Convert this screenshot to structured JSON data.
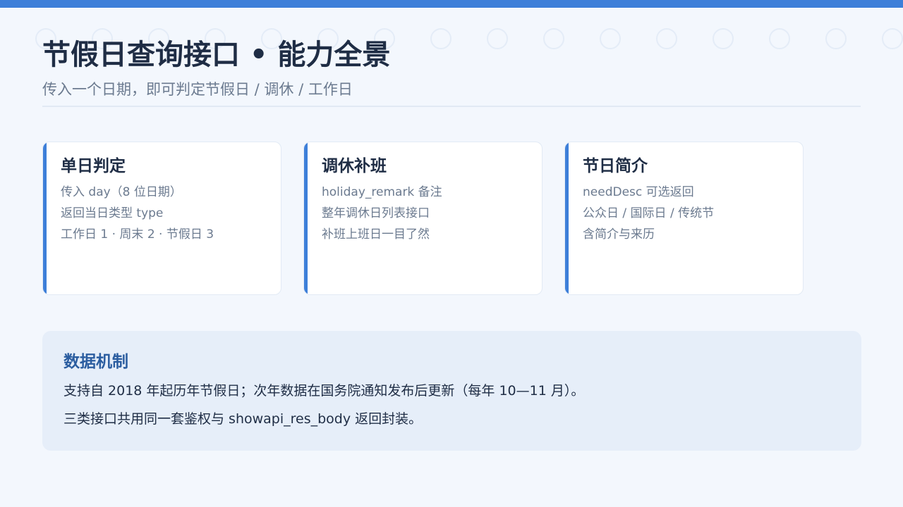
{
  "colors": {
    "accent": "#3d7fd9",
    "title": "#1f2d45",
    "muted": "#6b7a8f",
    "panel_title": "#2b5da0",
    "background": "#f3f7fd",
    "panel_background": "#e6eef9"
  },
  "header": {
    "title": "节假日查询接口 • 能力全景",
    "subtitle": "传入一个日期，即可判定节假日 / 调休 / 工作日"
  },
  "cards": [
    {
      "title": "单日判定",
      "lines": [
        "传入 day（8 位日期）",
        "返回当日类型 type",
        "工作日 1 · 周末 2 · 节假日 3"
      ]
    },
    {
      "title": "调休补班",
      "lines": [
        "holiday_remark 备注",
        "整年调休日列表接口",
        "补班上班日一目了然"
      ]
    },
    {
      "title": "节日简介",
      "lines": [
        "needDesc 可选返回",
        "公众日 / 国际日 / 传统节",
        "含简介与来历"
      ]
    }
  ],
  "data_mechanism": {
    "title": "数据机制",
    "lines": [
      "支持自 2018 年起历年节假日；次年数据在国务院通知发布后更新（每年 10—11 月）。",
      "三类接口共用同一套鉴权与 showapi_res_body 返回封装。"
    ]
  }
}
